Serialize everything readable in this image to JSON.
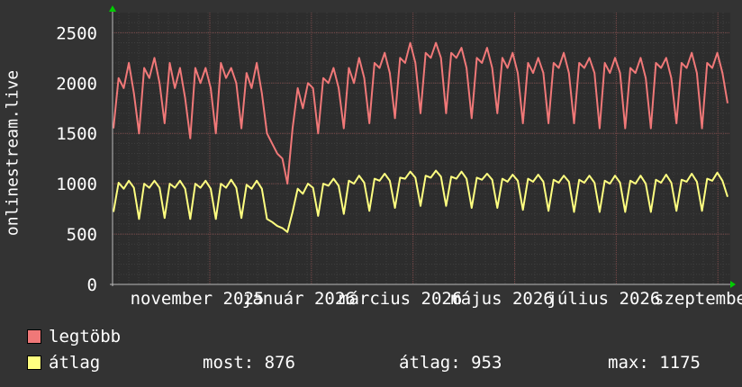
{
  "chart_data": {
    "type": "line",
    "ylabel": "onlinestream.live",
    "ylim": [
      0,
      2700
    ],
    "yticks": [
      0,
      500,
      1000,
      1500,
      2000,
      2500
    ],
    "x_tick_labels": [
      "november 2025",
      "január 2026",
      "március 2026",
      "május 2026",
      "július 2026",
      "szeptember"
    ],
    "grid": true,
    "series": [
      {
        "name": "legtöbb",
        "color": "#f07878",
        "values": [
          1550,
          2050,
          1950,
          2200,
          1900,
          1500,
          2150,
          2050,
          2250,
          2000,
          1600,
          2200,
          1950,
          2150,
          1850,
          1450,
          2150,
          2000,
          2150,
          1950,
          1500,
          2200,
          2050,
          2150,
          2000,
          1550,
          2100,
          1950,
          2200,
          1900,
          1500,
          1400,
          1300,
          1250,
          1000,
          1550,
          1950,
          1750,
          2000,
          1950,
          1500,
          2050,
          2000,
          2150,
          1950,
          1550,
          2150,
          2000,
          2250,
          2050,
          1600,
          2200,
          2150,
          2300,
          2100,
          1650,
          2250,
          2200,
          2400,
          2200,
          1700,
          2300,
          2250,
          2400,
          2250,
          1700,
          2300,
          2250,
          2350,
          2150,
          1650,
          2250,
          2200,
          2350,
          2150,
          1700,
          2250,
          2150,
          2300,
          2100,
          1600,
          2200,
          2100,
          2250,
          2100,
          1600,
          2200,
          2150,
          2300,
          2100,
          1600,
          2200,
          2150,
          2250,
          2100,
          1550,
          2200,
          2100,
          2250,
          2100,
          1550,
          2150,
          2100,
          2250,
          2050,
          1550,
          2200,
          2150,
          2250,
          2050,
          1600,
          2200,
          2150,
          2300,
          2100,
          1550,
          2200,
          2150,
          2300,
          2100,
          1800
        ],
        "labels": []
      },
      {
        "name": "átlag",
        "color": "#ffff80",
        "values": [
          720,
          1010,
          950,
          1030,
          960,
          650,
          1000,
          960,
          1030,
          960,
          660,
          1000,
          960,
          1030,
          950,
          650,
          1000,
          960,
          1030,
          950,
          650,
          1000,
          960,
          1040,
          960,
          660,
          990,
          950,
          1030,
          950,
          650,
          620,
          580,
          560,
          520,
          720,
          950,
          900,
          1000,
          960,
          680,
          1000,
          980,
          1050,
          980,
          700,
          1030,
          1000,
          1080,
          1010,
          730,
          1050,
          1030,
          1100,
          1030,
          760,
          1060,
          1050,
          1120,
          1060,
          780,
          1080,
          1060,
          1130,
          1070,
          780,
          1070,
          1050,
          1120,
          1050,
          760,
          1060,
          1040,
          1100,
          1040,
          760,
          1050,
          1020,
          1090,
          1030,
          740,
          1050,
          1020,
          1090,
          1020,
          730,
          1040,
          1010,
          1080,
          1020,
          720,
          1040,
          1010,
          1080,
          1010,
          720,
          1030,
          1000,
          1080,
          1010,
          720,
          1030,
          1000,
          1080,
          1000,
          720,
          1040,
          1010,
          1090,
          1010,
          730,
          1040,
          1020,
          1100,
          1020,
          730,
          1050,
          1030,
          1110,
          1030,
          870
        ],
        "labels": []
      }
    ]
  },
  "legend": {
    "items": [
      {
        "label": "legtöbb",
        "color": "#f07878"
      },
      {
        "label": "átlag",
        "color": "#ffff80"
      }
    ]
  },
  "stats": {
    "most": "most: 876",
    "atlag": "átlag: 953",
    "max": "max: 1175"
  }
}
